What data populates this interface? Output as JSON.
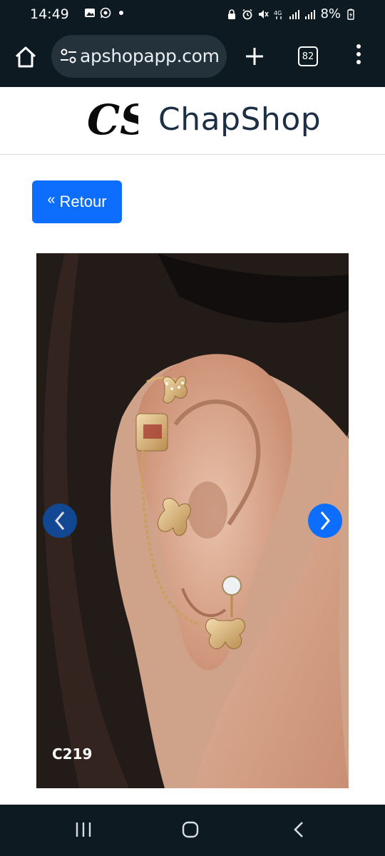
{
  "status_bar": {
    "time": "14:49",
    "network": "4G",
    "battery": "8%",
    "left_icons": [
      "gallery-icon",
      "whatsapp-icon",
      "dot-icon"
    ],
    "right_icons": [
      "lock-icon",
      "alarm-icon",
      "mute-icon",
      "network-4g-icon",
      "signal-icon",
      "signal-icon",
      "battery-charging-icon"
    ]
  },
  "browser": {
    "url": "apshopapp.com",
    "tab_count": "82"
  },
  "site": {
    "logo_text": "CS",
    "title": "ChapShop"
  },
  "back_button": {
    "icon": "«",
    "label": "Retour"
  },
  "product": {
    "code": "C219"
  },
  "colors": {
    "primary": "#0d6efd",
    "status_bg": "#0e1a22",
    "title": "#1c2f44"
  }
}
